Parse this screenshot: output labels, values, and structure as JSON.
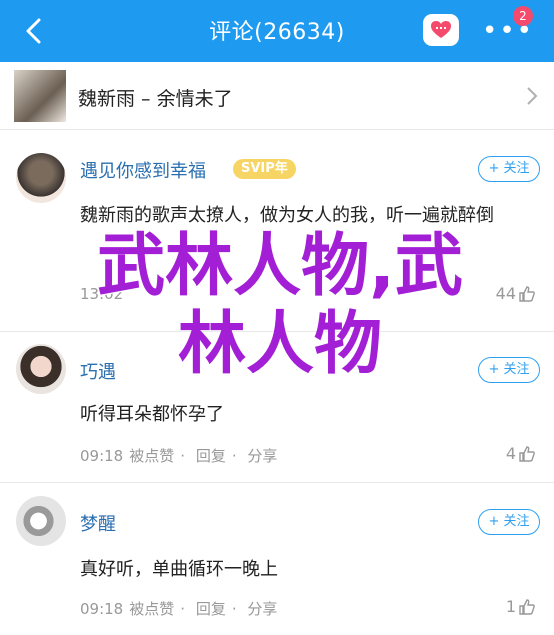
{
  "header": {
    "title": "评论(26634)",
    "notification_count": "2",
    "more_label": "•••"
  },
  "song": {
    "title": "魏新雨 – 余情未了"
  },
  "comments": [
    {
      "username": "遇见你感到幸福",
      "badge": "SVIP年",
      "follow_label": "+ 关注",
      "text": "魏新雨的歌声太撩人，做为女人的我，听一遍就醉倒",
      "time": "13:02",
      "like_count": "44"
    },
    {
      "username": "巧遇",
      "follow_label": "+ 关注",
      "text": "听得耳朵都怀孕了",
      "time": "09:18",
      "author_liked": "被点赞",
      "reply_label": "回复",
      "share_label": "分享",
      "like_count": "4"
    },
    {
      "username": "梦醒",
      "follow_label": "+ 关注",
      "text": "真好听，单曲循环一晚上",
      "time": "09:18",
      "author_liked": "被点赞",
      "reply_label": "回复",
      "share_label": "分享",
      "like_count": "1"
    }
  ],
  "watermark": {
    "line1": "武林人物,武",
    "line2": "林人物"
  },
  "colors": {
    "header_bg": "#1e9bf0",
    "accent": "#2f9ff0",
    "watermark": "#a31fd6"
  }
}
